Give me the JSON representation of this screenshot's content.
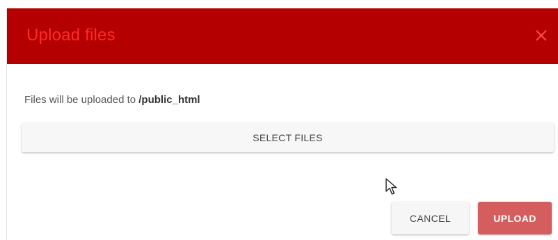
{
  "dialog": {
    "title": "Upload files",
    "close_icon": "close-icon",
    "info_prefix": "Files will be uploaded to ",
    "info_path": "/public_html",
    "select_files_label": "SELECT FILES",
    "cancel_label": "CANCEL",
    "upload_label": "UPLOAD"
  },
  "colors": {
    "header_background": "#b40000",
    "title_text": "#ff2a2a",
    "upload_button": "#d45d5d"
  },
  "icons": {
    "close": "close-icon",
    "mouse_cursor": "mouse-cursor-icon"
  }
}
